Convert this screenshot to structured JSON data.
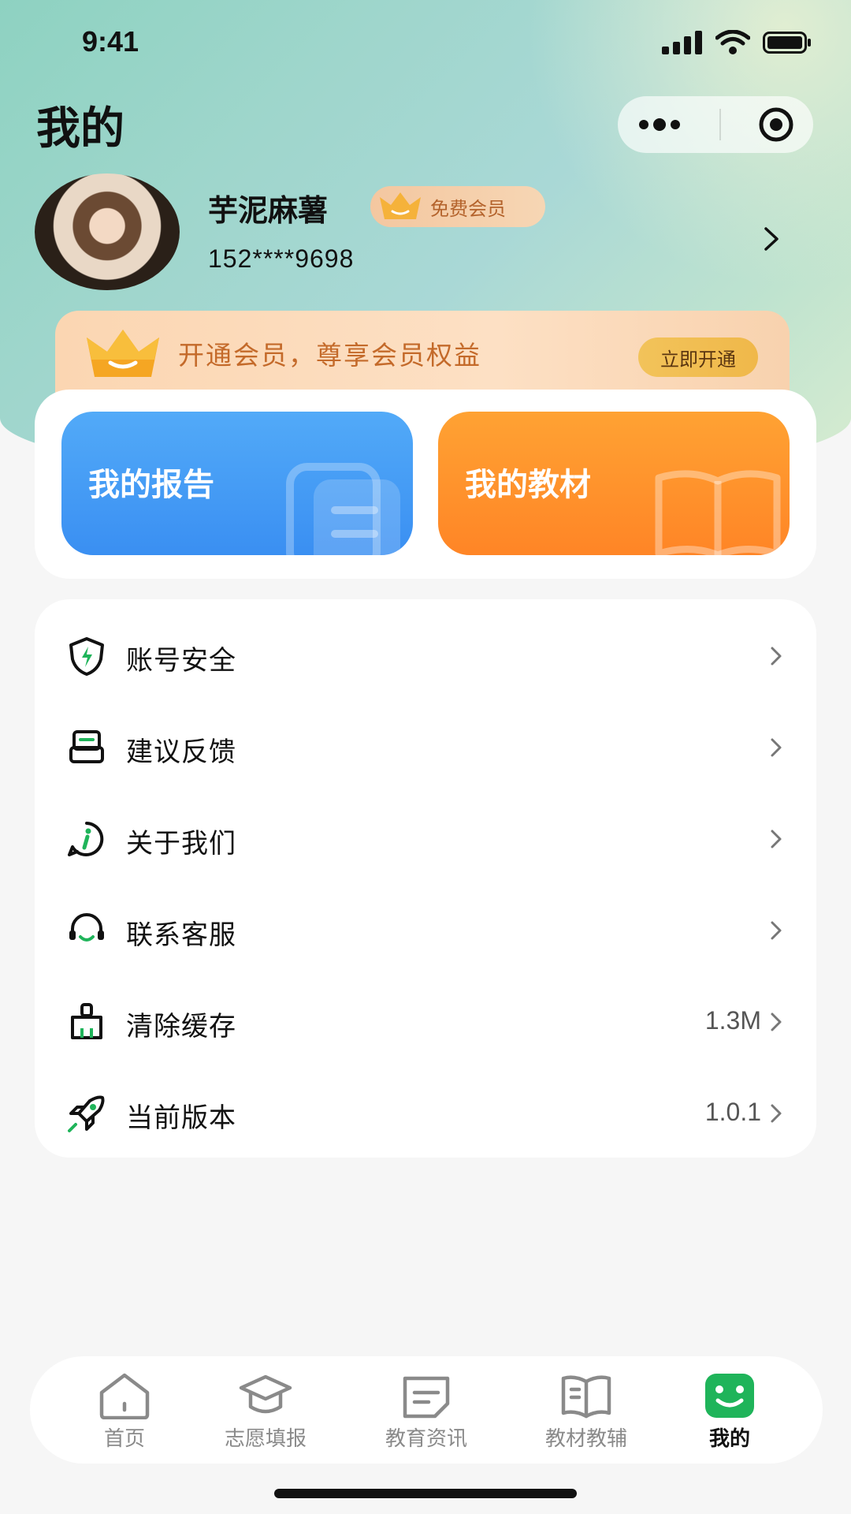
{
  "status_bar": {
    "time": "9:41"
  },
  "header": {
    "title": "我的"
  },
  "profile": {
    "name": "芋泥麻薯",
    "badge": "免费会员",
    "phone": "152****9698"
  },
  "vip_banner": {
    "text": "开通会员，尊享会员权益",
    "button": "立即开通"
  },
  "quick_actions": [
    {
      "label": "我的报告",
      "icon": "document-icon",
      "color": "#3f95f4"
    },
    {
      "label": "我的教材",
      "icon": "open-book-icon",
      "color": "#ff8e2a"
    }
  ],
  "menu": [
    {
      "label": "账号安全",
      "icon": "shield-icon",
      "value": ""
    },
    {
      "label": "建议反馈",
      "icon": "feedback-icon",
      "value": ""
    },
    {
      "label": "关于我们",
      "icon": "info-icon",
      "value": ""
    },
    {
      "label": "联系客服",
      "icon": "headset-icon",
      "value": ""
    },
    {
      "label": "清除缓存",
      "icon": "broom-icon",
      "value": "1.3M"
    },
    {
      "label": "当前版本",
      "icon": "rocket-icon",
      "value": "1.0.1"
    }
  ],
  "tabbar": [
    {
      "label": "首页",
      "icon": "home-icon",
      "active": false
    },
    {
      "label": "志愿填报",
      "icon": "graduation-cap-icon",
      "active": false
    },
    {
      "label": "教育资讯",
      "icon": "news-icon",
      "active": false
    },
    {
      "label": "教材教辅",
      "icon": "book-icon",
      "active": false
    },
    {
      "label": "我的",
      "icon": "smiley-icon",
      "active": true
    }
  ],
  "colors": {
    "accent_green": "#1fb45a",
    "vip_orange": "#c46a2a"
  }
}
